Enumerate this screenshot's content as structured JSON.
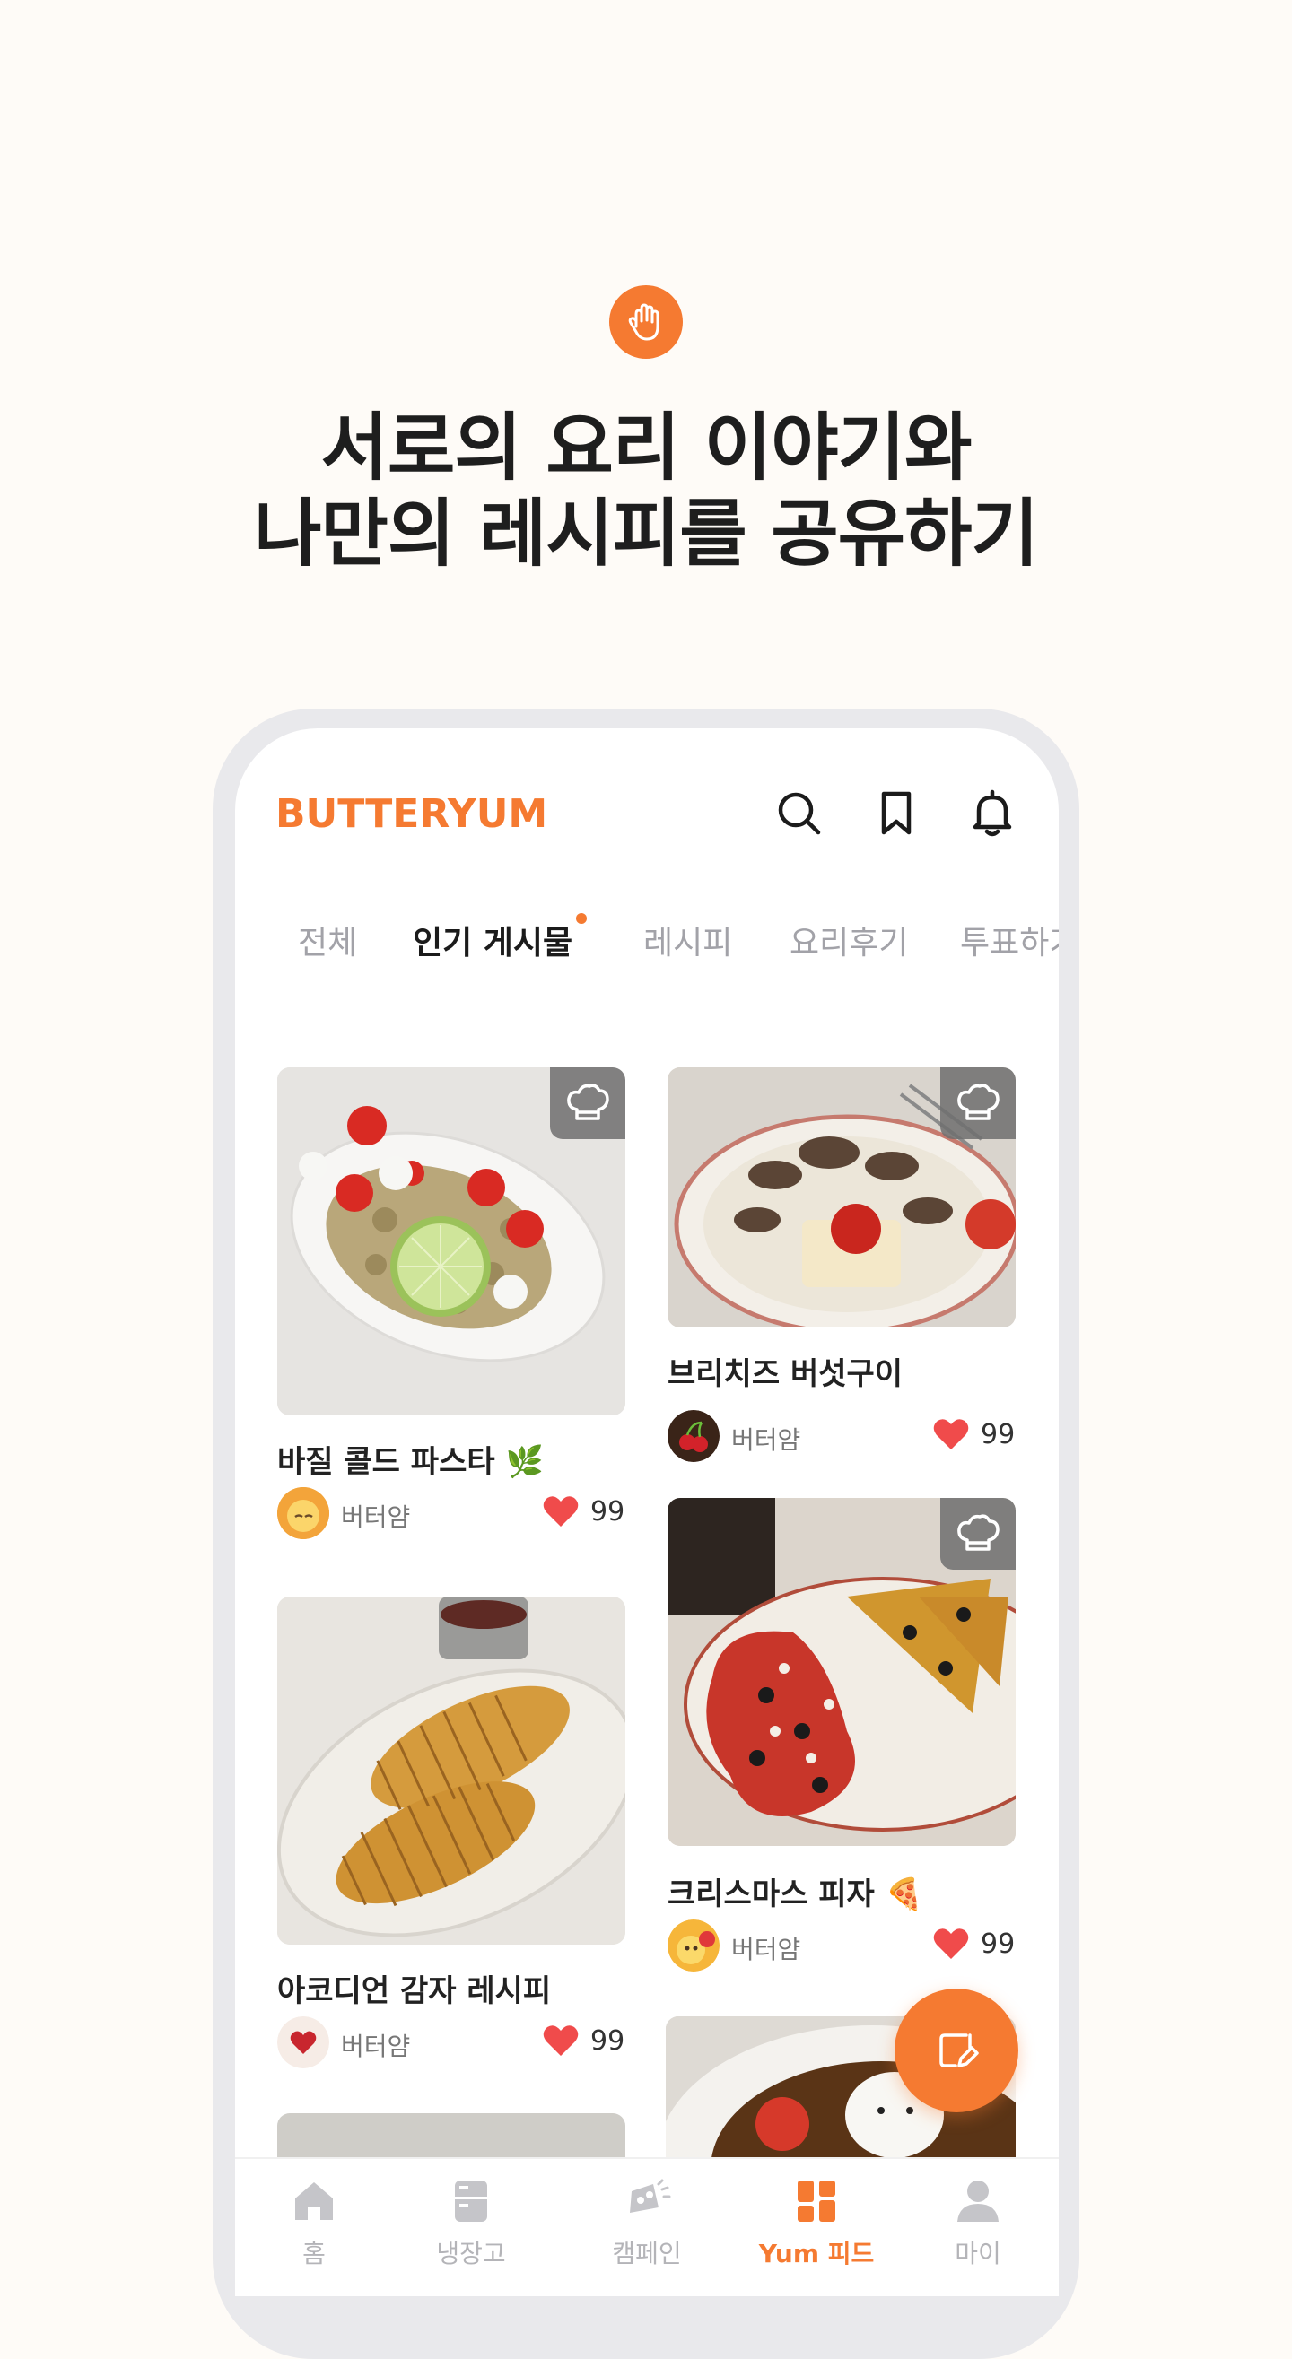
{
  "hero": {
    "title_line1": "서로의 요리 이야기와",
    "title_line2": "나만의 레시피를 공유하기",
    "icon": "hand-wave-icon"
  },
  "app": {
    "logo": "BUTTERYUM",
    "brand_color": "#f57a31"
  },
  "header": {
    "icons": [
      "search-icon",
      "bookmark-icon",
      "bell-icon"
    ]
  },
  "tabs": [
    {
      "label": "전체",
      "active": false
    },
    {
      "label": "인기 게시물",
      "active": true
    },
    {
      "label": "레시피",
      "active": false
    },
    {
      "label": "요리후기",
      "active": false
    },
    {
      "label": "투표하기",
      "active": false
    }
  ],
  "posts": [
    {
      "title": "바질 콜드 파스타 🌿",
      "author": "버터얌",
      "likes": "99",
      "chef_badge": true
    },
    {
      "title": "브리치즈 버섯구이",
      "author": "버터얌",
      "likes": "99",
      "chef_badge": true
    },
    {
      "title": "크리스마스 피자 🍕",
      "author": "버터얌",
      "likes": "99",
      "chef_badge": true
    },
    {
      "title": "아코디언 감자 레시피",
      "author": "버터얌",
      "likes": "99",
      "chef_badge": false
    }
  ],
  "fab": {
    "icon": "write-post-icon"
  },
  "bottom_nav": [
    {
      "label": "홈",
      "icon": "home-icon",
      "active": false
    },
    {
      "label": "냉장고",
      "icon": "fridge-icon",
      "active": false
    },
    {
      "label": "캠페인",
      "icon": "campaign-icon",
      "active": false
    },
    {
      "label": "Yum 피드",
      "icon": "feed-icon",
      "active": true
    },
    {
      "label": "마이",
      "icon": "profile-icon",
      "active": false
    }
  ]
}
